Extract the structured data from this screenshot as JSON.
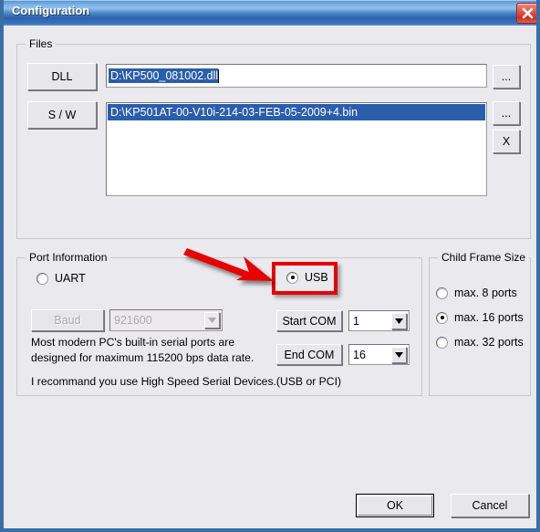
{
  "window": {
    "title": "Configuration",
    "close_icon": "close-icon",
    "accent_titlebar": "#3a72bb",
    "background": "#eae9ee",
    "annotation_color": "#e60000"
  },
  "files": {
    "group_label": "Files",
    "dll_button_label": "DLL",
    "dll_path_value": "D:\\KP500_081002.dll",
    "dll_browse_label": "...",
    "sw_button_label": "S / W",
    "sw_browse_label": "...",
    "sw_delete_label": "X",
    "sw_list_items": [
      "D:\\KP501AT-00-V10i-214-03-FEB-05-2009+4.bin"
    ]
  },
  "port_information": {
    "group_label": "Port Information",
    "options": [
      {
        "label": "UART",
        "selected": false
      },
      {
        "label": "USB",
        "selected": true
      }
    ],
    "baud_button_label": "Baud",
    "baud_value": "921600",
    "start_com_label": "Start COM",
    "start_com_value": "1",
    "end_com_label": "End COM",
    "end_com_value": "16",
    "info_line_1": "Most modern PC's built-in serial ports are",
    "info_line_2": "designed for maximum 115200 bps data rate.",
    "info_line_3": "I recommand you use High Speed Serial Devices.(USB or PCI)"
  },
  "child_frame_size": {
    "group_label": "Child Frame Size",
    "options": [
      {
        "label": "max. 8 ports",
        "selected": false
      },
      {
        "label": "max. 16 ports",
        "selected": true
      },
      {
        "label": "max. 32 ports",
        "selected": false
      }
    ]
  },
  "footer": {
    "ok_label": "OK",
    "cancel_label": "Cancel"
  }
}
